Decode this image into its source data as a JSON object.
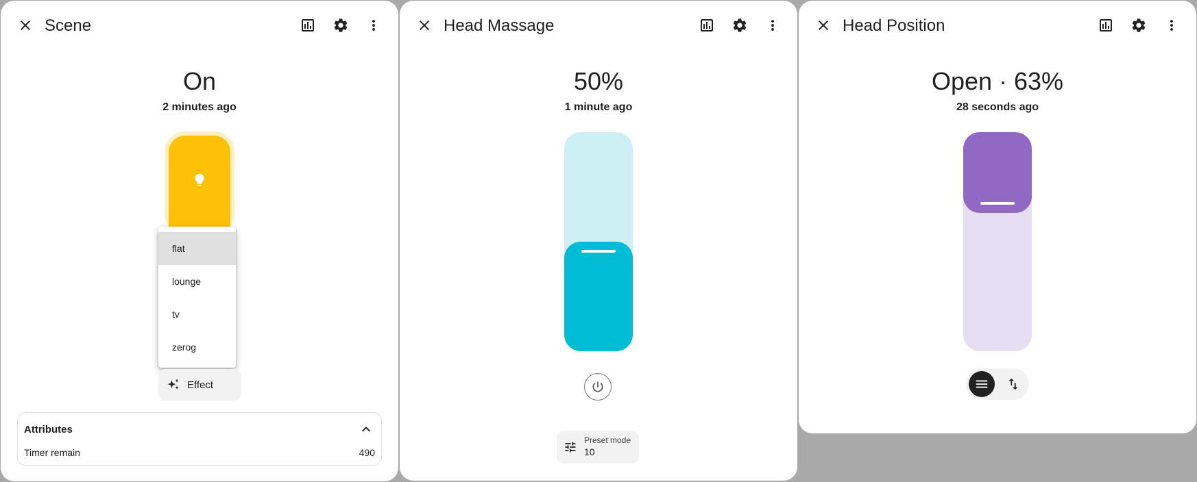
{
  "scene_dialog": {
    "title": "Scene",
    "state": "On",
    "last_changed": "2 minutes ago",
    "toggle_color": "#ffc107",
    "toggle_icon": "lightbulb-icon",
    "effect_menu": {
      "items": [
        "flat",
        "lounge",
        "tv",
        "zerog"
      ],
      "highlighted": "flat"
    },
    "effect_button_label": "Effect",
    "attributes": {
      "title": "Attributes",
      "rows": [
        {
          "key": "Timer remain",
          "value": "490"
        }
      ]
    }
  },
  "massage_dialog": {
    "title": "Head Massage",
    "state": "50%",
    "last_changed": "1 minute ago",
    "slider_level_percent": 50,
    "slider_color": "#00bcd4",
    "preset_mode": {
      "label": "Preset mode",
      "value": "10"
    }
  },
  "position_dialog": {
    "title": "Head Position",
    "state": "Open · 63%",
    "last_changed": "28 seconds ago",
    "position_percent": 63,
    "slider_color": "#9169c5",
    "mode_selected": "slider"
  }
}
